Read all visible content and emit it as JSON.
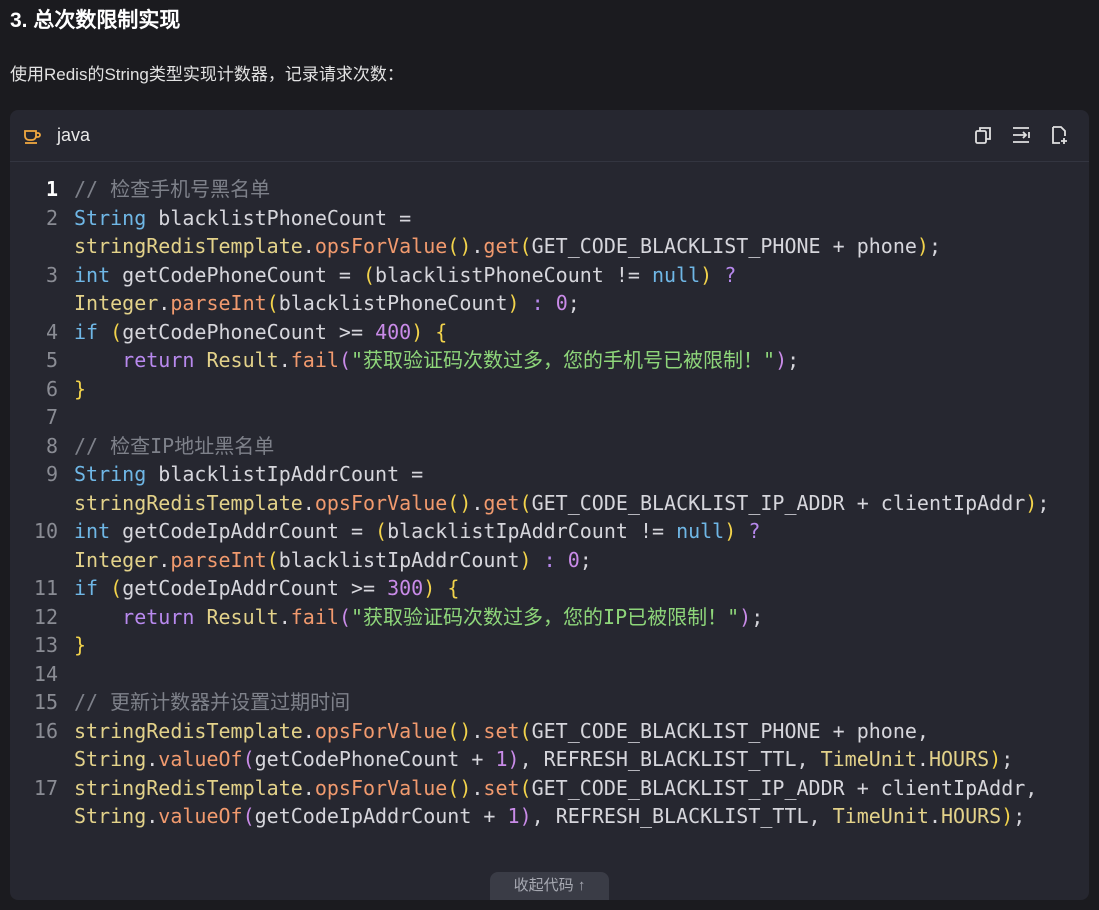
{
  "heading": "3. 总次数限制实现",
  "description": "使用Redis的String类型实现计数器，记录请求次数：",
  "code_block": {
    "language": "java",
    "collapse_label": "收起代码",
    "collapse_arrow": "↑",
    "icons": [
      "coffee-cup-icon",
      "copy-icon",
      "wrap-icon",
      "insert-file-icon"
    ],
    "lines": [
      {
        "number": "1",
        "active": true,
        "tokens": [
          {
            "c": "c",
            "t": "// 检查手机号黑名单"
          }
        ]
      },
      {
        "number": "2",
        "tokens": [
          {
            "c": "t",
            "t": "String"
          },
          {
            "c": "n",
            "t": " blacklistPhoneCount = "
          },
          {
            "c": "cl-name",
            "t": "stringRedisTemplate"
          },
          {
            "c": "n",
            "t": "."
          },
          {
            "c": "f",
            "t": "opsForValue"
          },
          {
            "c": "y",
            "t": "()"
          },
          {
            "c": "n",
            "t": "."
          },
          {
            "c": "f",
            "t": "get"
          },
          {
            "c": "y",
            "t": "("
          },
          {
            "c": "n",
            "t": "GET_CODE_BLACKLIST_PHONE + phone"
          },
          {
            "c": "y",
            "t": ")"
          },
          {
            "c": "n",
            "t": ";"
          }
        ]
      },
      {
        "number": "3",
        "tokens": [
          {
            "c": "t",
            "t": "int"
          },
          {
            "c": "n",
            "t": " getCodePhoneCount = "
          },
          {
            "c": "y",
            "t": "("
          },
          {
            "c": "n",
            "t": "blacklistPhoneCount != "
          },
          {
            "c": "t",
            "t": "null"
          },
          {
            "c": "y",
            "t": ")"
          },
          {
            "c": "n",
            "t": " "
          },
          {
            "c": "k",
            "t": "?"
          },
          {
            "c": "n",
            "t": " "
          },
          {
            "c": "cl-name",
            "t": "Integer"
          },
          {
            "c": "n",
            "t": "."
          },
          {
            "c": "f",
            "t": "parseInt"
          },
          {
            "c": "y",
            "t": "("
          },
          {
            "c": "n",
            "t": "blacklistPhoneCount"
          },
          {
            "c": "y",
            "t": ")"
          },
          {
            "c": "n",
            "t": " "
          },
          {
            "c": "k",
            "t": ":"
          },
          {
            "c": "n",
            "t": " "
          },
          {
            "c": "p",
            "t": "0"
          },
          {
            "c": "n",
            "t": ";"
          }
        ]
      },
      {
        "number": "4",
        "tokens": [
          {
            "c": "t",
            "t": "if"
          },
          {
            "c": "n",
            "t": " "
          },
          {
            "c": "y",
            "t": "("
          },
          {
            "c": "n",
            "t": "getCodePhoneCount >= "
          },
          {
            "c": "p",
            "t": "400"
          },
          {
            "c": "y",
            "t": ")"
          },
          {
            "c": "n",
            "t": " "
          },
          {
            "c": "y",
            "t": "{"
          }
        ]
      },
      {
        "number": "5",
        "tokens": [
          {
            "c": "n",
            "t": "    "
          },
          {
            "c": "k",
            "t": "return"
          },
          {
            "c": "n",
            "t": " "
          },
          {
            "c": "cl-name",
            "t": "Result"
          },
          {
            "c": "n",
            "t": "."
          },
          {
            "c": "f",
            "t": "fail"
          },
          {
            "c": "p",
            "t": "("
          },
          {
            "c": "s",
            "t": "\"获取验证码次数过多，您的手机号已被限制！\""
          },
          {
            "c": "p",
            "t": ")"
          },
          {
            "c": "n",
            "t": ";"
          }
        ]
      },
      {
        "number": "6",
        "tokens": [
          {
            "c": "y",
            "t": "}"
          }
        ]
      },
      {
        "number": "7",
        "tokens": []
      },
      {
        "number": "8",
        "tokens": [
          {
            "c": "c",
            "t": "// 检查IP地址黑名单"
          }
        ]
      },
      {
        "number": "9",
        "tokens": [
          {
            "c": "t",
            "t": "String"
          },
          {
            "c": "n",
            "t": " blacklistIpAddrCount = "
          },
          {
            "c": "cl-name",
            "t": "stringRedisTemplate"
          },
          {
            "c": "n",
            "t": "."
          },
          {
            "c": "f",
            "t": "opsForValue"
          },
          {
            "c": "y",
            "t": "()"
          },
          {
            "c": "n",
            "t": "."
          },
          {
            "c": "f",
            "t": "get"
          },
          {
            "c": "y",
            "t": "("
          },
          {
            "c": "n",
            "t": "GET_CODE_BLACKLIST_IP_ADDR + clientIpAddr"
          },
          {
            "c": "y",
            "t": ")"
          },
          {
            "c": "n",
            "t": ";"
          }
        ]
      },
      {
        "number": "10",
        "tokens": [
          {
            "c": "t",
            "t": "int"
          },
          {
            "c": "n",
            "t": " getCodeIpAddrCount = "
          },
          {
            "c": "y",
            "t": "("
          },
          {
            "c": "n",
            "t": "blacklistIpAddrCount != "
          },
          {
            "c": "t",
            "t": "null"
          },
          {
            "c": "y",
            "t": ")"
          },
          {
            "c": "n",
            "t": " "
          },
          {
            "c": "k",
            "t": "?"
          },
          {
            "c": "n",
            "t": " "
          },
          {
            "c": "cl-name",
            "t": "Integer"
          },
          {
            "c": "n",
            "t": "."
          },
          {
            "c": "f",
            "t": "parseInt"
          },
          {
            "c": "y",
            "t": "("
          },
          {
            "c": "n",
            "t": "blacklistIpAddrCount"
          },
          {
            "c": "y",
            "t": ")"
          },
          {
            "c": "n",
            "t": " "
          },
          {
            "c": "k",
            "t": ":"
          },
          {
            "c": "n",
            "t": " "
          },
          {
            "c": "p",
            "t": "0"
          },
          {
            "c": "n",
            "t": ";"
          }
        ]
      },
      {
        "number": "11",
        "tokens": [
          {
            "c": "t",
            "t": "if"
          },
          {
            "c": "n",
            "t": " "
          },
          {
            "c": "y",
            "t": "("
          },
          {
            "c": "n",
            "t": "getCodeIpAddrCount >= "
          },
          {
            "c": "p",
            "t": "300"
          },
          {
            "c": "y",
            "t": ")"
          },
          {
            "c": "n",
            "t": " "
          },
          {
            "c": "y",
            "t": "{"
          }
        ]
      },
      {
        "number": "12",
        "tokens": [
          {
            "c": "n",
            "t": "    "
          },
          {
            "c": "k",
            "t": "return"
          },
          {
            "c": "n",
            "t": " "
          },
          {
            "c": "cl-name",
            "t": "Result"
          },
          {
            "c": "n",
            "t": "."
          },
          {
            "c": "f",
            "t": "fail"
          },
          {
            "c": "p",
            "t": "("
          },
          {
            "c": "s",
            "t": "\"获取验证码次数过多，您的IP已被限制！\""
          },
          {
            "c": "p",
            "t": ")"
          },
          {
            "c": "n",
            "t": ";"
          }
        ]
      },
      {
        "number": "13",
        "tokens": [
          {
            "c": "y",
            "t": "}"
          }
        ]
      },
      {
        "number": "14",
        "tokens": []
      },
      {
        "number": "15",
        "tokens": [
          {
            "c": "c",
            "t": "// 更新计数器并设置过期时间"
          }
        ]
      },
      {
        "number": "16",
        "tokens": [
          {
            "c": "cl-name",
            "t": "stringRedisTemplate"
          },
          {
            "c": "n",
            "t": "."
          },
          {
            "c": "f",
            "t": "opsForValue"
          },
          {
            "c": "y",
            "t": "()"
          },
          {
            "c": "n",
            "t": "."
          },
          {
            "c": "f",
            "t": "set"
          },
          {
            "c": "y",
            "t": "("
          },
          {
            "c": "n",
            "t": "GET_CODE_BLACKLIST_PHONE + phone, "
          },
          {
            "c": "cl-name",
            "t": "String"
          },
          {
            "c": "n",
            "t": "."
          },
          {
            "c": "f",
            "t": "valueOf"
          },
          {
            "c": "p",
            "t": "("
          },
          {
            "c": "n",
            "t": "getCodePhoneCount + "
          },
          {
            "c": "p",
            "t": "1"
          },
          {
            "c": "p",
            "t": ")"
          },
          {
            "c": "n",
            "t": ", REFRESH_BLACKLIST_TTL, "
          },
          {
            "c": "cl-name",
            "t": "TimeUnit"
          },
          {
            "c": "n",
            "t": "."
          },
          {
            "c": "cl-name",
            "t": "HOURS"
          },
          {
            "c": "y",
            "t": ")"
          },
          {
            "c": "n",
            "t": ";"
          }
        ]
      },
      {
        "number": "17",
        "tokens": [
          {
            "c": "cl-name",
            "t": "stringRedisTemplate"
          },
          {
            "c": "n",
            "t": "."
          },
          {
            "c": "f",
            "t": "opsForValue"
          },
          {
            "c": "y",
            "t": "()"
          },
          {
            "c": "n",
            "t": "."
          },
          {
            "c": "f",
            "t": "set"
          },
          {
            "c": "y",
            "t": "("
          },
          {
            "c": "n",
            "t": "GET_CODE_BLACKLIST_IP_ADDR + clientIpAddr, "
          },
          {
            "c": "cl-name",
            "t": "String"
          },
          {
            "c": "n",
            "t": "."
          },
          {
            "c": "f",
            "t": "valueOf"
          },
          {
            "c": "p",
            "t": "("
          },
          {
            "c": "n",
            "t": "getCodeIpAddrCount + "
          },
          {
            "c": "p",
            "t": "1"
          },
          {
            "c": "p",
            "t": ")"
          },
          {
            "c": "n",
            "t": ", REFRESH_BLACKLIST_TTL, "
          },
          {
            "c": "cl-name",
            "t": "TimeUnit"
          },
          {
            "c": "n",
            "t": "."
          },
          {
            "c": "cl-name",
            "t": "HOURS"
          },
          {
            "c": "y",
            "t": ")"
          },
          {
            "c": "n",
            "t": ";"
          }
        ]
      }
    ]
  }
}
